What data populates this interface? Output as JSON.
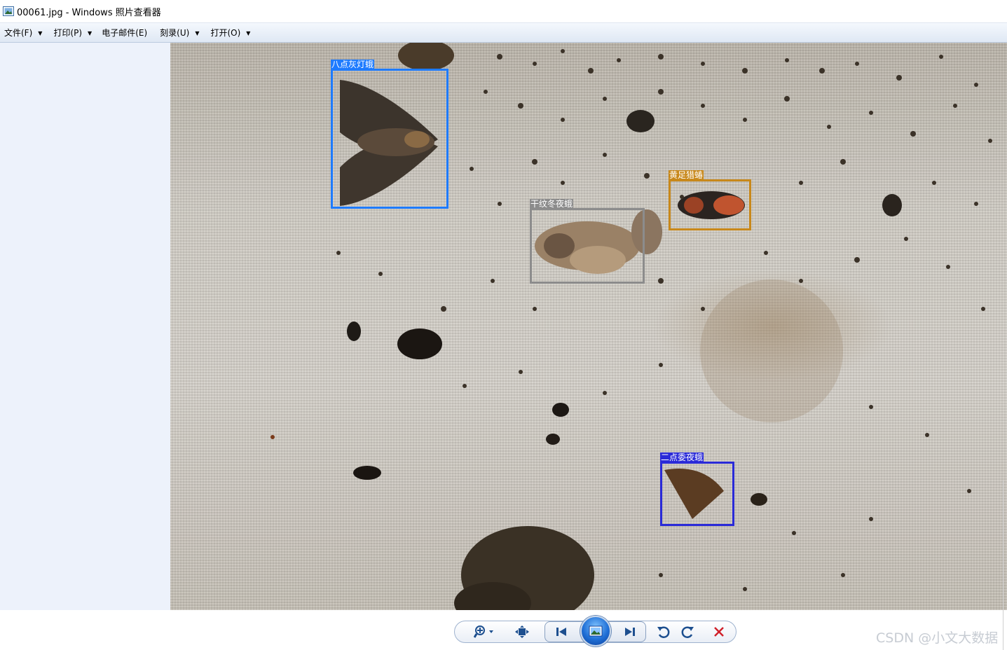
{
  "window": {
    "title": "00061.jpg - Windows 照片查看器",
    "icon": "photo-viewer-icon"
  },
  "menu": [
    {
      "label": "文件(F)",
      "has_dropdown": true
    },
    {
      "label": "打印(P)",
      "has_dropdown": true
    },
    {
      "label": "电子邮件(E)",
      "has_dropdown": false
    },
    {
      "label": "刻录(U)",
      "has_dropdown": true
    },
    {
      "label": "打开(O)",
      "has_dropdown": true
    }
  ],
  "detections": [
    {
      "label": "八点灰灯蛾",
      "color": "#1e7bff"
    },
    {
      "label": "干纹冬夜蛾",
      "color": "#8c8c8c"
    },
    {
      "label": "黄足猎蝽",
      "color": "#c8881a"
    },
    {
      "label": "二点委夜蛾",
      "color": "#2a2ad8"
    }
  ],
  "toolbar": {
    "buttons": [
      "zoom-icon",
      "fit-to-window-icon",
      "previous-icon",
      "slideshow-icon",
      "next-icon",
      "rotate-counterclockwise-icon",
      "rotate-clockwise-icon",
      "delete-icon"
    ]
  },
  "watermark": "CSDN @小文大数据",
  "colors": {
    "menubar": "#dfe8f4",
    "left_pane": "#edf2fb",
    "delete": "#d0202a",
    "toolbar_icon": "#1d4f8f"
  }
}
